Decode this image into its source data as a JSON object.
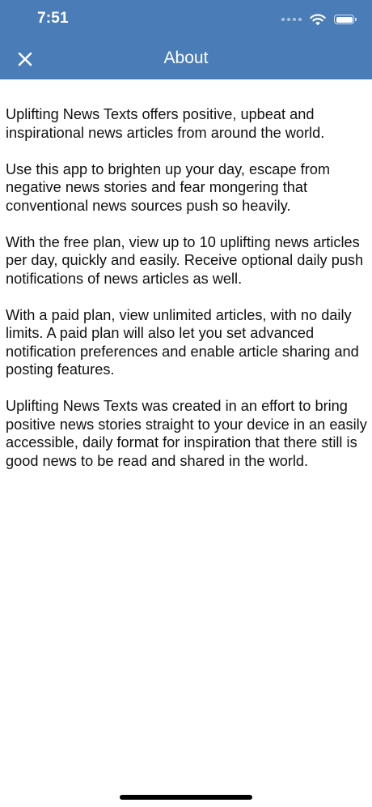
{
  "status_bar": {
    "time": "7:51",
    "icons": [
      "signal-icon",
      "wifi-icon",
      "battery-icon"
    ]
  },
  "nav": {
    "title": "About",
    "close_icon": "close-icon"
  },
  "colors": {
    "header_bg": "#4a7db8",
    "header_text": "#ffffff",
    "body_text": "#111111"
  },
  "about": {
    "paragraphs": [
      "Uplifting News Texts offers positive, upbeat and inspirational news articles from around the world.",
      "Use this app to brighten up your day, escape from negative news stories and fear mongering that conventional news sources push so heavily.",
      "With the free plan, view up to 10 uplifting news articles per day, quickly and easily. Receive optional daily push notifications of news articles as well.",
      "With a paid plan, view unlimited articles, with no daily limits. A paid plan will also let you set advanced notification preferences and enable article sharing and posting features.",
      "Uplifting News Texts was created in an effort to bring positive news stories straight to your device in an easily accessible, daily format for inspiration that there still is good news to be read and shared in the world."
    ]
  }
}
